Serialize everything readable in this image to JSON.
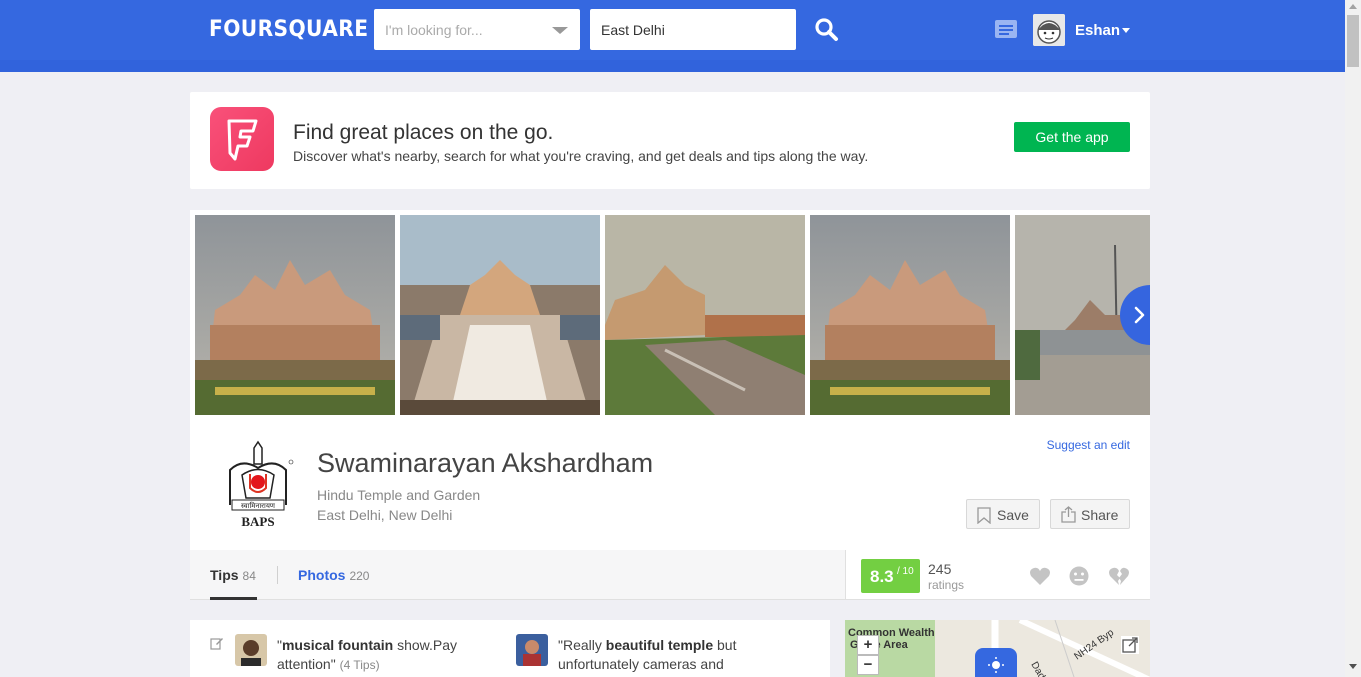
{
  "header": {
    "logo": "FOURSQUARE",
    "search_what_placeholder": "I'm looking for...",
    "search_where_value": "East Delhi",
    "username": "Eshan"
  },
  "promo": {
    "title": "Find great places on the go.",
    "subtitle": "Discover what's nearby, search for what you're craving, and get deals and tips along the way.",
    "cta": "Get the app"
  },
  "venue": {
    "name": "Swaminarayan Akshardham",
    "category": "Hindu Temple and Garden",
    "location": "East Delhi, New Delhi",
    "suggest_edit": "Suggest an edit",
    "save_label": "Save",
    "share_label": "Share",
    "logo_text": "BAPS",
    "logo_banner": "स्वामिनारायण"
  },
  "tabs": [
    {
      "label": "Tips",
      "count": "84"
    },
    {
      "label": "Photos",
      "count": "220"
    }
  ],
  "rating": {
    "score": "8.3",
    "scale": "/ 10",
    "count": "245",
    "label": "ratings"
  },
  "tips": [
    {
      "pre": "\"",
      "bold": "musical fountain",
      "post": " show.Pay",
      "line2": "attention\"",
      "meta": "(4 Tips)"
    },
    {
      "pre": "\"Really ",
      "bold": "beautiful temple",
      "post": " but",
      "line2": "unfortunately cameras and",
      "meta": ""
    }
  ],
  "map": {
    "label1": "Common Wealth",
    "label2": "Game Area",
    "road1": "Dadri",
    "road2": "NH24 Byp",
    "zoom_in": "+",
    "zoom_out": "−"
  },
  "colors": {
    "brand_blue": "#3568e0",
    "app_pink": "#f0436a",
    "cta_green": "#00b551",
    "rating_green": "#73cf42"
  }
}
